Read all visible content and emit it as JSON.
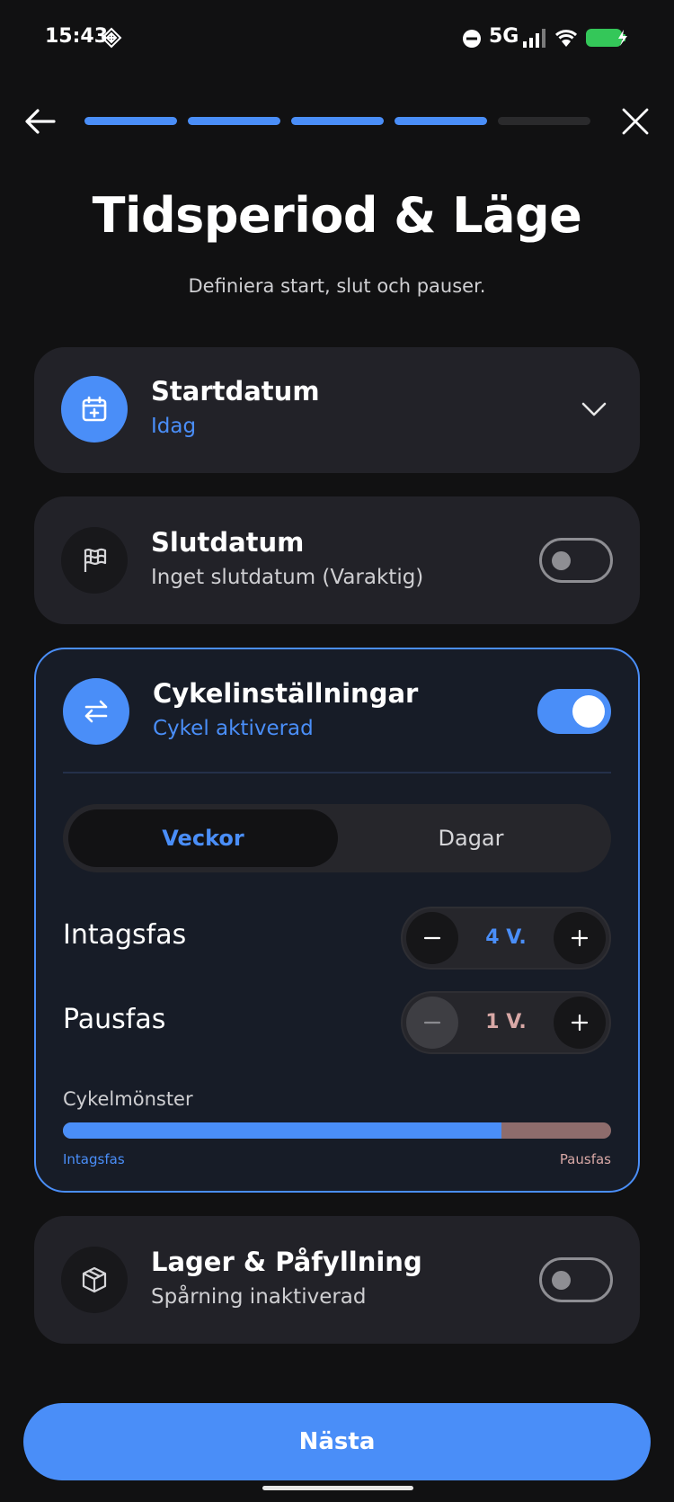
{
  "status_bar": {
    "time": "15:43",
    "network": "5G",
    "icons": [
      "grid-diamond-icon",
      "do-not-disturb-icon",
      "signal-icon",
      "wifi-icon",
      "battery-charging-icon"
    ]
  },
  "nav": {
    "back_icon": "arrow-left-icon",
    "close_icon": "close-icon",
    "progress_total": 5,
    "progress_completed": 4
  },
  "header": {
    "title": "Tidsperiod & Läge",
    "subtitle": "Definiera start, slut och pauser."
  },
  "start_date": {
    "title": "Startdatum",
    "value": "Idag",
    "icon": "calendar-plus-icon"
  },
  "end_date": {
    "title": "Slutdatum",
    "value": "Inget slutdatum (Varaktig)",
    "icon": "flag-icon",
    "enabled": false
  },
  "cycle": {
    "title": "Cykelinställningar",
    "status": "Cykel aktiverad",
    "icon": "swap-arrows-icon",
    "enabled": true,
    "unit_options": [
      "Veckor",
      "Dagar"
    ],
    "selected_unit": "Veckor",
    "intake": {
      "label": "Intagsfas",
      "value": "4 V."
    },
    "pause": {
      "label": "Pausfas",
      "value": "1 V."
    },
    "pattern_label": "Cykelmönster",
    "pattern_intake_label": "Intagsfas",
    "pattern_pause_label": "Pausfas",
    "pattern_intake_fraction": 0.8
  },
  "inventory": {
    "title": "Lager & Påfyllning",
    "status": "Spårning inaktiverad",
    "icon": "box-icon",
    "enabled": false
  },
  "footer": {
    "next_label": "Nästa"
  },
  "colors": {
    "accent": "#4a8ef8",
    "pause": "#8e6c6c",
    "background": "#111112",
    "card": "#222228"
  }
}
